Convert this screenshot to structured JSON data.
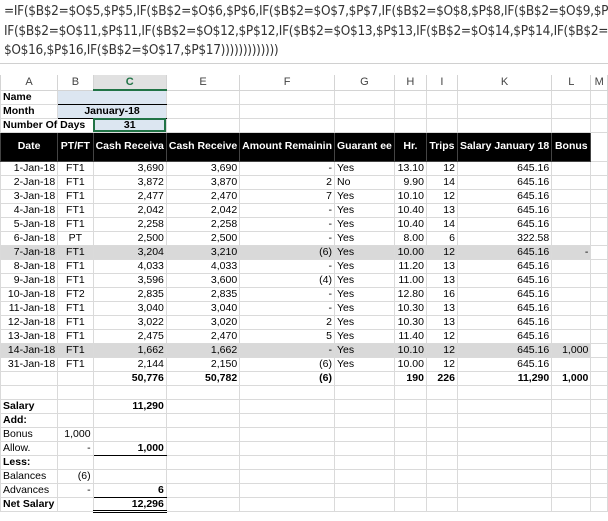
{
  "formula_bar": {
    "lines": [
      "=IF($B$2=$O$5,$P$5,IF($B$2=$O$6,$P$6,IF($B$2=$O$7,$P$7,IF($B$2=$O$8,$P$8,IF($B$2=$O$9,$P$9,",
      "IF($B$2=$O$11,$P$11,IF($B$2=$O$12,$P$12,IF($B$2=$O$13,$P$13,IF($B$2=$O$14,$P$14,IF($B$2=$O",
      "$O$16,$P$16,IF($B$2=$O$17,$P$17)))))))))))))"
    ]
  },
  "columns": [
    "A",
    "B",
    "C",
    "E",
    "F",
    "G",
    "H",
    "I",
    "K",
    "L",
    "M"
  ],
  "selected_column": "C",
  "info": {
    "name_label": "Name",
    "name_value": "",
    "month_label": "Month",
    "month_value": "January-18",
    "days_label": "Number Of Days",
    "days_value": "31"
  },
  "table_headers": [
    "Date",
    "PT/FT",
    "Cash Receiva",
    "Cash Receive",
    "Amount Remainin",
    "Guarant ee",
    "Hr.",
    "Trips",
    "Salary January 18",
    "Bonus"
  ],
  "rows": [
    [
      "1-Jan-18",
      "FT1",
      "3,690",
      "3,690",
      "-",
      "Yes",
      "13.10",
      "12",
      "645.16",
      ""
    ],
    [
      "2-Jan-18",
      "FT1",
      "3,872",
      "3,870",
      "2",
      "No",
      "9.90",
      "14",
      "645.16",
      ""
    ],
    [
      "3-Jan-18",
      "FT1",
      "2,477",
      "2,470",
      "7",
      "Yes",
      "10.10",
      "12",
      "645.16",
      ""
    ],
    [
      "4-Jan-18",
      "FT1",
      "2,042",
      "2,042",
      "-",
      "Yes",
      "10.40",
      "13",
      "645.16",
      ""
    ],
    [
      "5-Jan-18",
      "FT1",
      "2,258",
      "2,258",
      "-",
      "Yes",
      "10.40",
      "14",
      "645.16",
      ""
    ],
    [
      "6-Jan-18",
      "PT",
      "2,500",
      "2,500",
      "-",
      "Yes",
      "8.00",
      "6",
      "322.58",
      ""
    ],
    [
      "7-Jan-18",
      "FT1",
      "3,204",
      "3,210",
      "(6)",
      "Yes",
      "10.00",
      "12",
      "645.16",
      "-"
    ],
    [
      "8-Jan-18",
      "FT1",
      "4,033",
      "4,033",
      "-",
      "Yes",
      "11.20",
      "13",
      "645.16",
      ""
    ],
    [
      "9-Jan-18",
      "FT1",
      "3,596",
      "3,600",
      "(4)",
      "Yes",
      "11.00",
      "13",
      "645.16",
      ""
    ],
    [
      "10-Jan-18",
      "FT2",
      "2,835",
      "2,835",
      "-",
      "Yes",
      "12.80",
      "16",
      "645.16",
      ""
    ],
    [
      "11-Jan-18",
      "FT1",
      "3,040",
      "3,040",
      "-",
      "Yes",
      "10.30",
      "13",
      "645.16",
      ""
    ],
    [
      "12-Jan-18",
      "FT1",
      "3,022",
      "3,020",
      "2",
      "Yes",
      "10.30",
      "13",
      "645.16",
      ""
    ],
    [
      "13-Jan-18",
      "FT1",
      "2,475",
      "2,470",
      "5",
      "Yes",
      "11.40",
      "12",
      "645.16",
      ""
    ],
    [
      "14-Jan-18",
      "FT1",
      "1,662",
      "1,662",
      "-",
      "Yes",
      "10.10",
      "12",
      "645.16",
      "1,000"
    ],
    [
      "31-Jan-18",
      "FT1",
      "2,144",
      "2,150",
      "(6)",
      "Yes",
      "10.00",
      "12",
      "645.16",
      ""
    ]
  ],
  "highlighted_rows": [
    6,
    13
  ],
  "totals": [
    "",
    "",
    "50,776",
    "50,782",
    "(6)",
    "",
    "190",
    "226",
    "11,290",
    "1,000"
  ],
  "summary": [
    {
      "label": "Salary",
      "b": "",
      "c": "11,290",
      "bold": true
    },
    {
      "label": "Add:",
      "b": "",
      "c": "",
      "bold": true
    },
    {
      "label": "Bonus",
      "b": "1,000",
      "c": "",
      "bold": false
    },
    {
      "label": "Allow.",
      "b": "-",
      "c": "1,000",
      "bold": false
    },
    {
      "label": "Less:",
      "b": "",
      "c": "",
      "bold": true
    },
    {
      "label": "Balances",
      "b": "(6)",
      "c": "",
      "bold": false
    },
    {
      "label": "Advances",
      "b": "-",
      "c": "6",
      "bold": false
    },
    {
      "label": "Net Salary",
      "b": "",
      "c": "12,296",
      "bold": true
    }
  ]
}
